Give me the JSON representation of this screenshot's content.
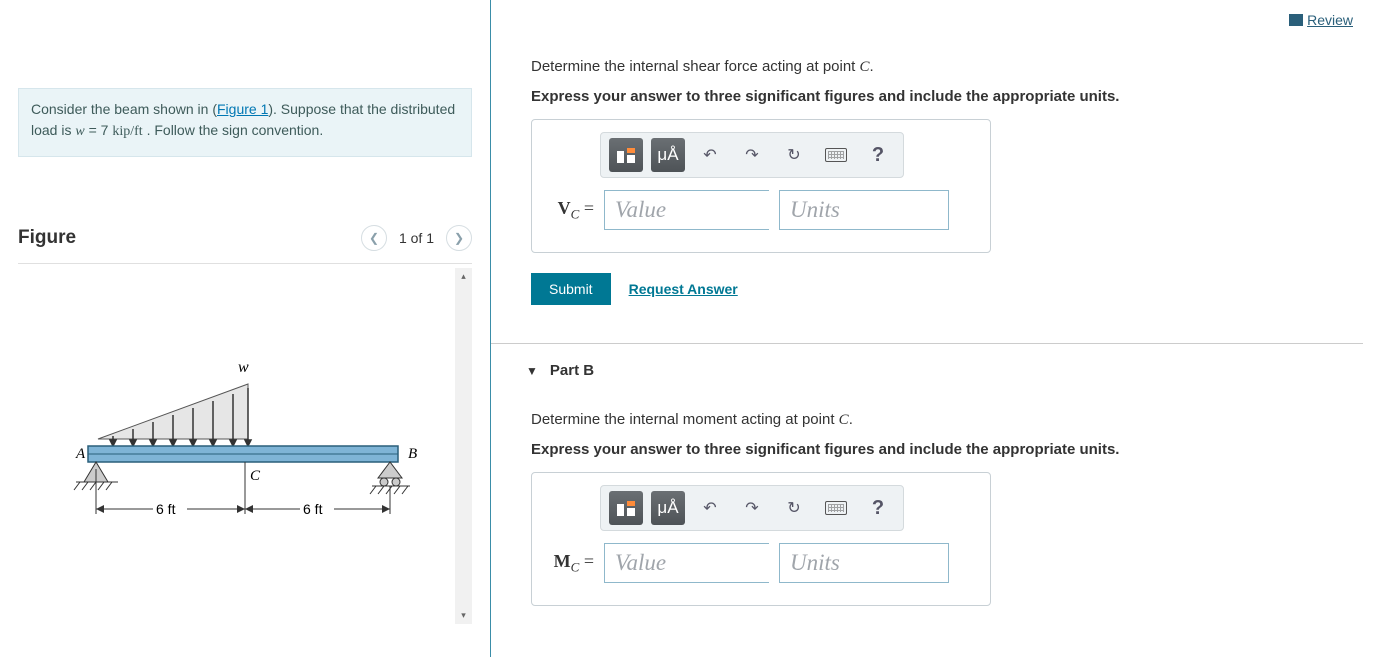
{
  "header": {
    "review": "Review"
  },
  "problem": {
    "pre": "Consider the beam shown in (",
    "figure_link": "Figure 1",
    "post_link": "). Suppose that the distributed load is ",
    "var": "w",
    "eq": " = 7 ",
    "unit": "kip/ft",
    "tail": " . Follow the sign convention."
  },
  "figure": {
    "title": "Figure",
    "counter": "1 of 1",
    "labels": {
      "w": "w",
      "A": "A",
      "B": "B",
      "C": "C",
      "dim": "6 ft"
    }
  },
  "partA": {
    "prompt": "Determine the internal shear force acting at point ",
    "point": "C",
    "period": ".",
    "subprompt": "Express your answer to three significant figures and include the appropriate units.",
    "label_var": "V",
    "label_sub": "C",
    "value_ph": "Value",
    "units_ph": "Units",
    "submit": "Submit",
    "request": "Request Answer",
    "toolbar": {
      "units_btn": "μÅ",
      "help": "?"
    }
  },
  "partB": {
    "title": "Part B",
    "prompt": "Determine the internal moment acting at point ",
    "point": "C",
    "period": ".",
    "subprompt": "Express your answer to three significant figures and include the appropriate units.",
    "label_var": "M",
    "label_sub": "C",
    "value_ph": "Value",
    "units_ph": "Units",
    "toolbar": {
      "units_btn": "μÅ",
      "help": "?"
    }
  }
}
